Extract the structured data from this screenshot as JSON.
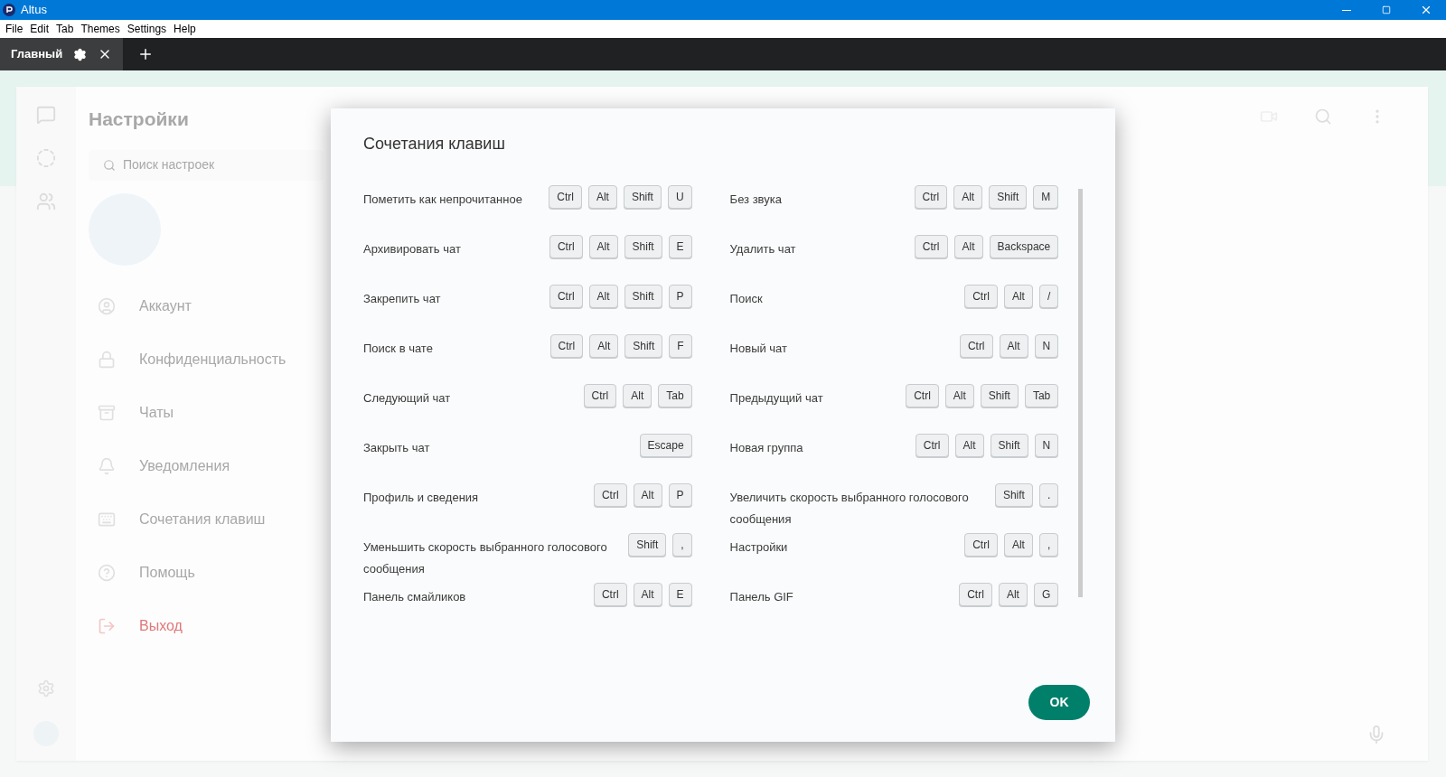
{
  "window": {
    "title": "Altus"
  },
  "menu": [
    "File",
    "Edit",
    "Tab",
    "Themes",
    "Settings",
    "Help"
  ],
  "tabs": [
    {
      "label": "Главный",
      "selected": true
    }
  ],
  "background": {
    "settings_title": "Настройки",
    "search": {
      "placeholder": "Поиск настроек"
    },
    "items": [
      {
        "label": "Аккаунт",
        "kind": "account"
      },
      {
        "label": "Конфиденциальность",
        "kind": "privacy"
      },
      {
        "label": "Чаты",
        "kind": "chats"
      },
      {
        "label": "Уведомления",
        "kind": "notifications"
      },
      {
        "label": "Сочетания клавиш",
        "kind": "shortcuts"
      },
      {
        "label": "Помощь",
        "kind": "help"
      },
      {
        "label": "Выход",
        "kind": "logout"
      }
    ]
  },
  "dialog": {
    "title": "Сочетания клавиш",
    "shortcuts": [
      {
        "label": "Пометить как непрочитанное",
        "keys": [
          "Ctrl",
          "Alt",
          "Shift",
          "U"
        ]
      },
      {
        "label": "Без звука",
        "keys": [
          "Ctrl",
          "Alt",
          "Shift",
          "M"
        ]
      },
      {
        "label": "Архивировать чат",
        "keys": [
          "Ctrl",
          "Alt",
          "Shift",
          "E"
        ]
      },
      {
        "label": "Удалить чат",
        "keys": [
          "Ctrl",
          "Alt",
          "Backspace"
        ]
      },
      {
        "label": "Закрепить чат",
        "keys": [
          "Ctrl",
          "Alt",
          "Shift",
          "P"
        ]
      },
      {
        "label": "Поиск",
        "keys": [
          "Ctrl",
          "Alt",
          "/"
        ]
      },
      {
        "label": "Поиск в чате",
        "keys": [
          "Ctrl",
          "Alt",
          "Shift",
          "F"
        ]
      },
      {
        "label": "Новый чат",
        "keys": [
          "Ctrl",
          "Alt",
          "N"
        ]
      },
      {
        "label": "Следующий чат",
        "keys": [
          "Ctrl",
          "Alt",
          "Tab"
        ]
      },
      {
        "label": "Предыдущий чат",
        "keys": [
          "Ctrl",
          "Alt",
          "Shift",
          "Tab"
        ]
      },
      {
        "label": "Закрыть чат",
        "keys": [
          "Escape"
        ]
      },
      {
        "label": "Новая группа",
        "keys": [
          "Ctrl",
          "Alt",
          "Shift",
          "N"
        ]
      },
      {
        "label": "Профиль и сведения",
        "keys": [
          "Ctrl",
          "Alt",
          "P"
        ]
      },
      {
        "label": "Увеличить скорость выбранного голосового сообщения",
        "keys": [
          "Shift",
          "."
        ]
      },
      {
        "label": "Уменьшить скорость выбранного голосового сообщения",
        "keys": [
          "Shift",
          ","
        ]
      },
      {
        "label": "Настройки",
        "keys": [
          "Ctrl",
          "Alt",
          ","
        ]
      },
      {
        "label": "Панель смайликов",
        "keys": [
          "Ctrl",
          "Alt",
          "E"
        ]
      },
      {
        "label": "Панель GIF",
        "keys": [
          "Ctrl",
          "Alt",
          "G"
        ]
      }
    ],
    "ok": "OK"
  }
}
